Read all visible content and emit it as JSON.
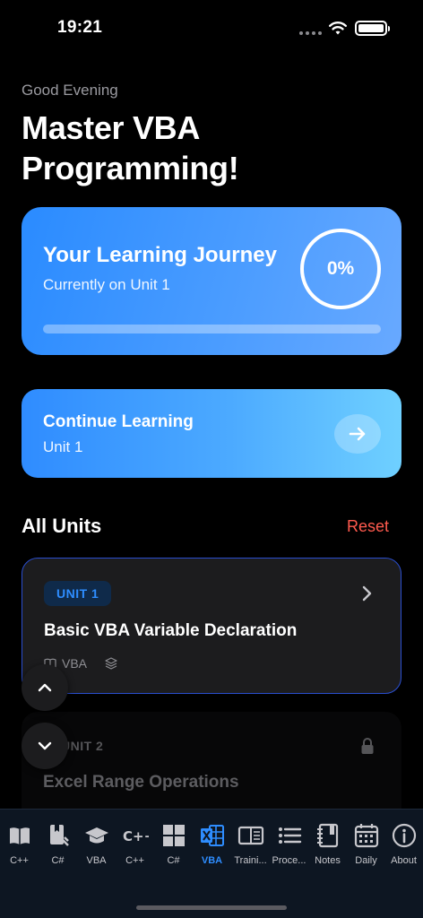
{
  "status_bar": {
    "time": "19:21"
  },
  "header": {
    "greeting": "Good Evening",
    "title": "Master VBA Programming!"
  },
  "journey": {
    "title": "Your Learning Journey",
    "subtitle": "Currently on Unit 1",
    "percent_label": "0%",
    "progress": 0
  },
  "continue": {
    "title": "Continue Learning",
    "subtitle": "Unit 1"
  },
  "units_section": {
    "title": "All Units",
    "reset_label": "Reset"
  },
  "units": [
    {
      "badge": "UNIT 1",
      "title": "Basic VBA Variable Declaration",
      "language": "VBA",
      "locked": false
    },
    {
      "badge": "UNIT 2",
      "title": "Excel Range Operations",
      "locked": true
    }
  ],
  "tabs": [
    {
      "label": "C++",
      "icon": "book-icon"
    },
    {
      "label": "C#",
      "icon": "book-bookmark-icon"
    },
    {
      "label": "VBA",
      "icon": "graduation-cap-icon"
    },
    {
      "label": "C++",
      "icon": "cpp-icon"
    },
    {
      "label": "C#",
      "icon": "windows-grid-icon"
    },
    {
      "label": "VBA",
      "icon": "excel-icon",
      "active": true
    },
    {
      "label": "Traini...",
      "icon": "training-book-icon"
    },
    {
      "label": "Proce...",
      "icon": "list-icon"
    },
    {
      "label": "Notes",
      "icon": "notebook-icon"
    },
    {
      "label": "Daily",
      "icon": "calendar-icon"
    },
    {
      "label": "About",
      "icon": "info-icon"
    }
  ],
  "colors": {
    "accent": "#2E8DFF",
    "reset": "#FF5A4E",
    "card": "#1C1C1E",
    "tabbar": "#0D1622"
  }
}
